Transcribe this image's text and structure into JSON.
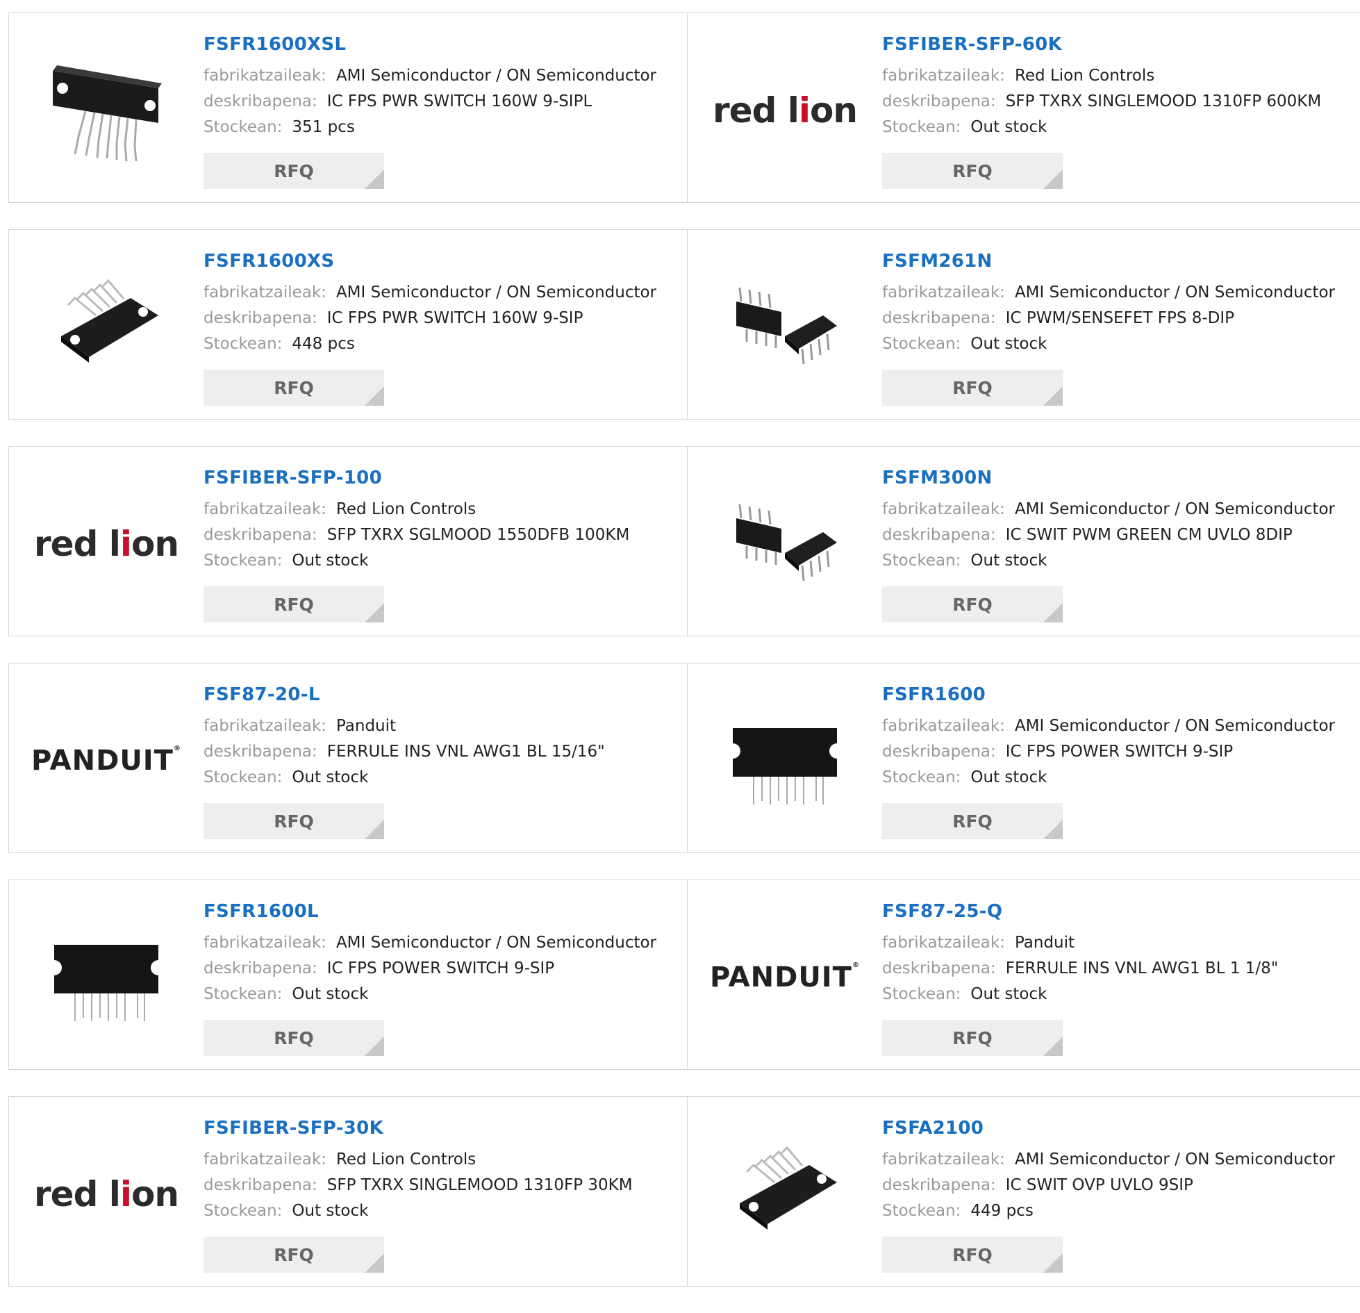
{
  "labels": {
    "manufacturer": "fabrikatzaileak:",
    "description": "deskribapena:",
    "stock": "Stockean:",
    "rfq": "RFQ"
  },
  "products": [
    {
      "part": "FSFR1600XSL",
      "manufacturer": "AMI Semiconductor / ON Semiconductor",
      "description": "IC FPS PWR SWITCH 160W 9-SIPL",
      "stock": "351 pcs",
      "image": "sipl-package-icon"
    },
    {
      "part": "FSFIBER-SFP-60K",
      "manufacturer": "Red Lion Controls",
      "description": "SFP TXRX SINGLEMOOD 1310FP 600KM",
      "stock": "Out stock",
      "image": "redlion-logo"
    },
    {
      "part": "FSFR1600XS",
      "manufacturer": "AMI Semiconductor / ON Semiconductor",
      "description": "IC FPS PWR SWITCH 160W 9-SIP",
      "stock": "448 pcs",
      "image": "sip-package-angled-icon"
    },
    {
      "part": "FSFM261N",
      "manufacturer": "AMI Semiconductor / ON Semiconductor",
      "description": "IC PWM/SENSEFET FPS 8-DIP",
      "stock": "Out stock",
      "image": "dip8-package-icon"
    },
    {
      "part": "FSFIBER-SFP-100",
      "manufacturer": "Red Lion Controls",
      "description": "SFP TXRX SGLMOOD 1550DFB 100KM",
      "stock": "Out stock",
      "image": "redlion-logo"
    },
    {
      "part": "FSFM300N",
      "manufacturer": "AMI Semiconductor / ON Semiconductor",
      "description": "IC SWIT PWM GREEN CM UVLO 8DIP",
      "stock": "Out stock",
      "image": "dip8-package-icon"
    },
    {
      "part": "FSF87-20-L",
      "manufacturer": "Panduit",
      "description": "FERRULE INS VNL AWG1 BL 15/16\"",
      "stock": "Out stock",
      "image": "panduit-logo"
    },
    {
      "part": "FSFR1600",
      "manufacturer": "AMI Semiconductor / ON Semiconductor",
      "description": "IC FPS POWER SWITCH 9-SIP",
      "stock": "Out stock",
      "image": "sip-package-front-icon"
    },
    {
      "part": "FSFR1600L",
      "manufacturer": "AMI Semiconductor / ON Semiconductor",
      "description": "IC FPS POWER SWITCH 9-SIP",
      "stock": "Out stock",
      "image": "sip-package-front-icon"
    },
    {
      "part": "FSF87-25-Q",
      "manufacturer": "Panduit",
      "description": "FERRULE INS VNL AWG1 BL 1 1/8\"",
      "stock": "Out stock",
      "image": "panduit-logo"
    },
    {
      "part": "FSFIBER-SFP-30K",
      "manufacturer": "Red Lion Controls",
      "description": "SFP TXRX SINGLEMOOD 1310FP 30KM",
      "stock": "Out stock",
      "image": "redlion-logo"
    },
    {
      "part": "FSFA2100",
      "manufacturer": "AMI Semiconductor / ON Semiconductor",
      "description": "IC SWIT OVP UVLO 9SIP",
      "stock": "449 pcs",
      "image": "sip-package-angled-icon"
    }
  ],
  "logos": {
    "redlion": "red lion",
    "panduit": "PANDUIT"
  },
  "colors": {
    "part_link": "#1a6fc0",
    "label": "#9a9a9a",
    "brand_red": "#c8102e"
  }
}
